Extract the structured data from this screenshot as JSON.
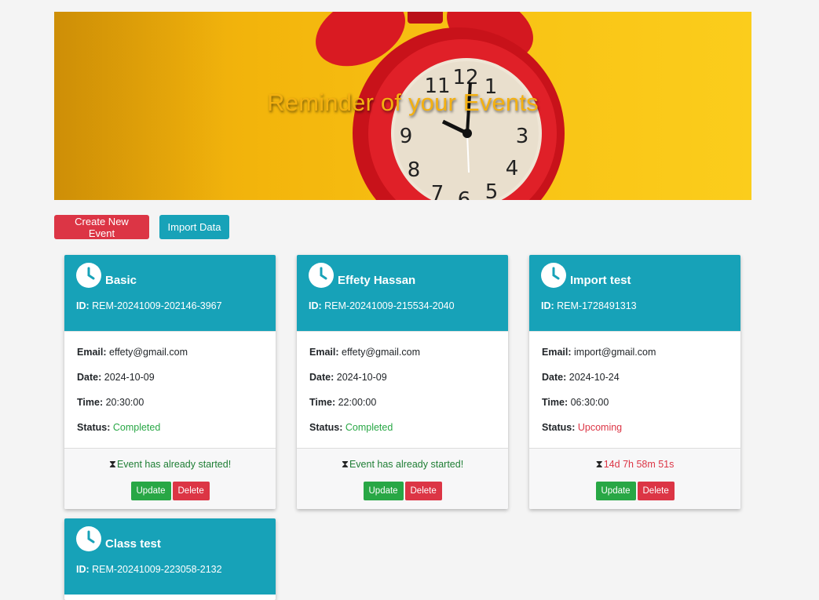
{
  "banner": {
    "title": "Reminder of your Events"
  },
  "toolbar": {
    "create_label": "Create New Event",
    "import_label": "Import Data"
  },
  "labels": {
    "id": "ID:",
    "email": "Email:",
    "date": "Date:",
    "time": "Time:",
    "status": "Status:",
    "update": "Update",
    "delete": "Delete"
  },
  "colors": {
    "header": "#17a2b8",
    "create_button": "#dc3545",
    "import_button": "#17a2b8",
    "completed": "#28a745",
    "upcoming": "#dc3545"
  },
  "events": [
    {
      "title": "Basic",
      "id": "REM-20241009-202146-3967",
      "email": "effety@gmail.com",
      "date": "2024-10-09",
      "time": "20:30:00",
      "status": "Completed",
      "countdown": "Event has already started!",
      "icon": "clock-icon"
    },
    {
      "title": "Effety Hassan",
      "id": "REM-20241009-215534-2040",
      "email": "effety@gmail.com",
      "date": "2024-10-09",
      "time": "22:00:00",
      "status": "Completed",
      "countdown": "Event has already started!",
      "icon": "clock-icon"
    },
    {
      "title": "Import test",
      "id": "REM-1728491313",
      "email": "import@gmail.com",
      "date": "2024-10-24",
      "time": "06:30:00",
      "status": "Upcoming",
      "countdown": "14d 7h 58m 51s",
      "icon": "clock-icon"
    },
    {
      "title": "Class test",
      "id": "REM-20241009-223058-2132",
      "icon": "clock-icon"
    }
  ]
}
